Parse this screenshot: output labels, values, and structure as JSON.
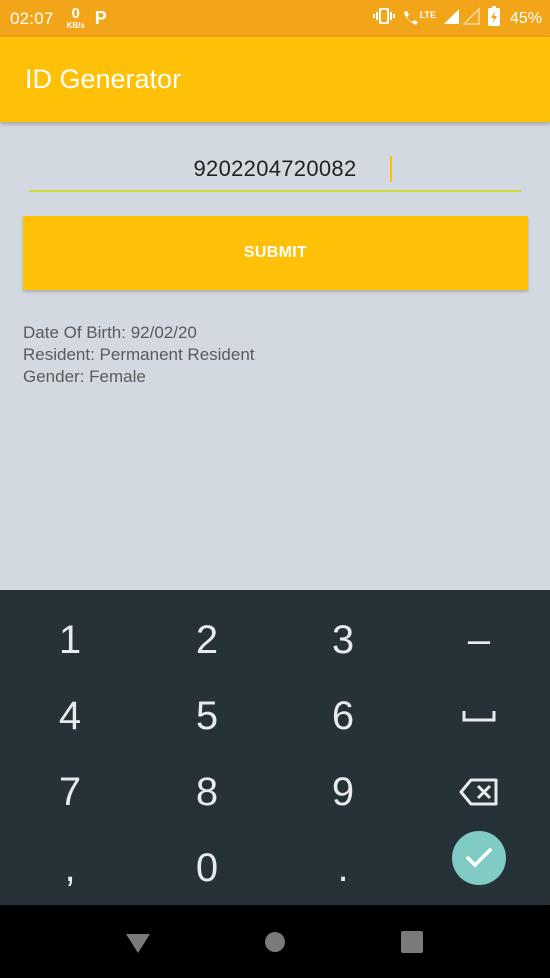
{
  "status_bar": {
    "time": "02:07",
    "speed_value": "0",
    "speed_unit": "KB/s",
    "app_badge": "P",
    "network_label": "LTE",
    "battery": "45%"
  },
  "app_bar": {
    "title": "ID Generator"
  },
  "form": {
    "id_value": "9202204720082",
    "submit_label": "SUBMIT"
  },
  "results": {
    "dob": "Date Of Birth: 92/02/20",
    "resident": "Resident: Permanent Resident",
    "gender": "Gender: Female"
  },
  "keyboard": {
    "k1": "1",
    "k2": "2",
    "k3": "3",
    "minus": "–",
    "k4": "4",
    "k5": "5",
    "k6": "6",
    "k7": "7",
    "k8": "8",
    "k9": "9",
    "comma": ",",
    "k0": "0",
    "period": "."
  },
  "colors": {
    "status_bar": "#f3a51a",
    "app_bar": "#ffc107",
    "accent_underline": "#cddc39",
    "keyboard_bg": "#263238",
    "done_button": "#80cbc4"
  },
  "icons": [
    "vibrate-icon",
    "wifi-calling-icon",
    "signal-icon",
    "battery-charging-icon",
    "space-icon",
    "backspace-icon",
    "check-icon",
    "back-icon",
    "home-icon",
    "recents-icon"
  ]
}
